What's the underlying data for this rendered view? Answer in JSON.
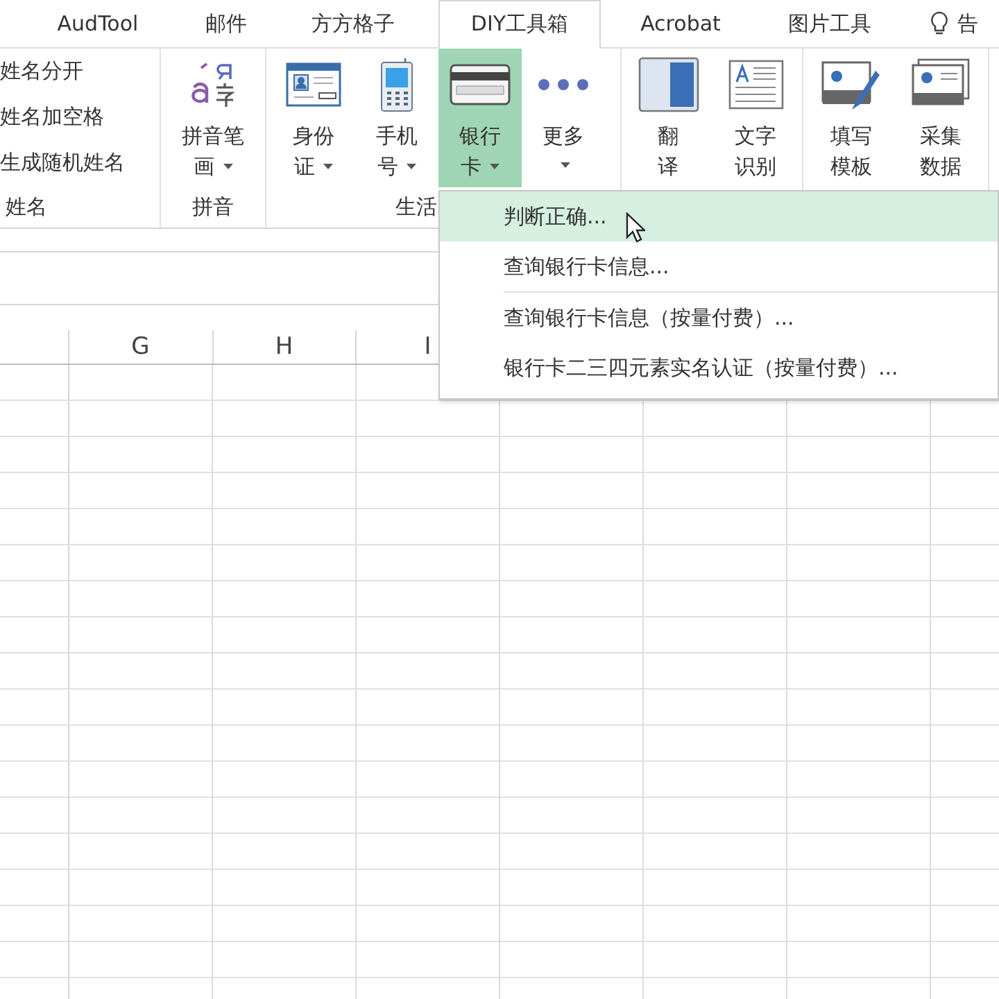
{
  "tabs": [
    {
      "label": "AudTool",
      "selected": false
    },
    {
      "label": "邮件",
      "selected": false
    },
    {
      "label": "方方格子",
      "selected": false
    },
    {
      "label": "DIY工具箱",
      "selected": true
    },
    {
      "label": "Acrobat",
      "selected": false
    },
    {
      "label": "图片工具",
      "selected": false
    }
  ],
  "tell_me": "告",
  "ribbon": {
    "groups": [
      {
        "label": "姓名",
        "items": [
          {
            "kind": "small",
            "label": "姓名分开"
          },
          {
            "kind": "small",
            "label": "姓名加空格"
          },
          {
            "kind": "small",
            "label": "生成随机姓名"
          }
        ]
      },
      {
        "label": "拼音",
        "items": [
          {
            "kind": "large",
            "lines": [
              "拼音笔",
              "画"
            ],
            "dropdown": true,
            "selected": false
          }
        ]
      },
      {
        "label": "生活",
        "items": [
          {
            "kind": "large",
            "lines": [
              "身份",
              "证"
            ],
            "dropdown": true,
            "selected": false
          },
          {
            "kind": "large",
            "lines": [
              "手机",
              "号"
            ],
            "dropdown": true,
            "selected": false
          },
          {
            "kind": "large",
            "lines": [
              "银行",
              "卡"
            ],
            "dropdown": true,
            "selected": true
          },
          {
            "kind": "large",
            "lines": [
              "更多"
            ],
            "dropdown": true,
            "selected": false
          }
        ]
      },
      {
        "items": [
          {
            "kind": "large",
            "lines": [
              "翻",
              "译"
            ],
            "dropdown": false,
            "selected": false
          },
          {
            "kind": "large",
            "lines": [
              "文字",
              "识别"
            ],
            "dropdown": false,
            "selected": false
          }
        ]
      },
      {
        "items": [
          {
            "kind": "large",
            "lines": [
              "填写",
              "模板"
            ],
            "dropdown": false,
            "selected": false
          },
          {
            "kind": "large",
            "lines": [
              "采集",
              "数据"
            ],
            "dropdown": false,
            "selected": false
          }
        ]
      }
    ]
  },
  "columns": [
    "G",
    "H",
    "I"
  ],
  "menu": [
    {
      "label": "判断正确...",
      "selected": true,
      "separator_after": false
    },
    {
      "label": "查询银行卡信息...",
      "selected": false,
      "separator_after": true
    },
    {
      "label": "查询银行卡信息（按量付费）...",
      "selected": false,
      "separator_after": false
    },
    {
      "label": "银行卡二三四元素实名认证（按量付费）...",
      "selected": false,
      "separator_after": false
    }
  ]
}
